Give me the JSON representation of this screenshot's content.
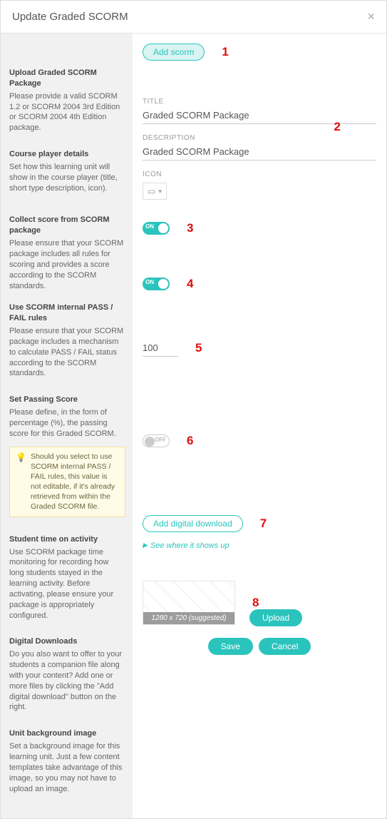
{
  "dialog": {
    "title": "Update Graded SCORM"
  },
  "annotations": {
    "n1": "1",
    "n2": "2",
    "n3": "3",
    "n4": "4",
    "n5": "5",
    "n6": "6",
    "n7": "7",
    "n8": "8"
  },
  "sidebar": {
    "upload": {
      "heading": "Upload Graded SCORM Package",
      "desc": "Please provide a valid SCORM 1.2 or SCORM 2004 3rd Edition or SCORM 2004 4th Edition package."
    },
    "player": {
      "heading": "Course player details",
      "desc": "Set how this learning unit will show in the course player (title, short type description, icon)."
    },
    "collect": {
      "heading": "Collect score from SCORM package",
      "desc": "Please ensure that your SCORM package includes all rules for scoring and provides a score according to the SCORM standards."
    },
    "passfail": {
      "heading": "Use SCORM internal PASS / FAIL rules",
      "desc": "Please ensure that your SCORM package includes a mechanism to calculate PASS / FAIL status according to the SCORM standards."
    },
    "setpass": {
      "heading": "Set Passing Score",
      "desc": "Please define, in the form of percentage (%), the passing score for this Graded SCORM."
    },
    "tip": {
      "text": "Should you select to use SCORM internal PASS / FAIL rules, this value is not editable, if it's already retrieved from within the Graded SCORM file."
    },
    "time": {
      "heading": "Student time on activity",
      "desc": "Use SCORM package time monitoring for recording how long students stayed in the learning activity. Before activating, please ensure your package is appropriately configured."
    },
    "downloads": {
      "heading": "Digital Downloads",
      "desc": "Do you also want to offer to your students a companion file along with your content? Add one or more files by clicking the \"Add digital download\" button on the right."
    },
    "bgimg": {
      "heading": "Unit background image",
      "desc": "Set a background image for this learning unit. Just a few content templates take advantage of this image, so you may not have to upload an image."
    }
  },
  "main": {
    "add_scorm": "Add scorm",
    "title_label": "TITLE",
    "title_value": "Graded SCORM Package",
    "desc_label": "DESCRIPTION",
    "desc_value": "Graded SCORM Package",
    "icon_label": "ICON",
    "toggle_on_label": "ON",
    "toggle_off_label": "OFF",
    "passing_score": "100",
    "add_download": "Add digital download",
    "see_where": "See where it shows up",
    "bg_hint": "1280 x 720 (suggested)",
    "upload_btn": "Upload",
    "save_btn": "Save",
    "cancel_btn": "Cancel"
  }
}
